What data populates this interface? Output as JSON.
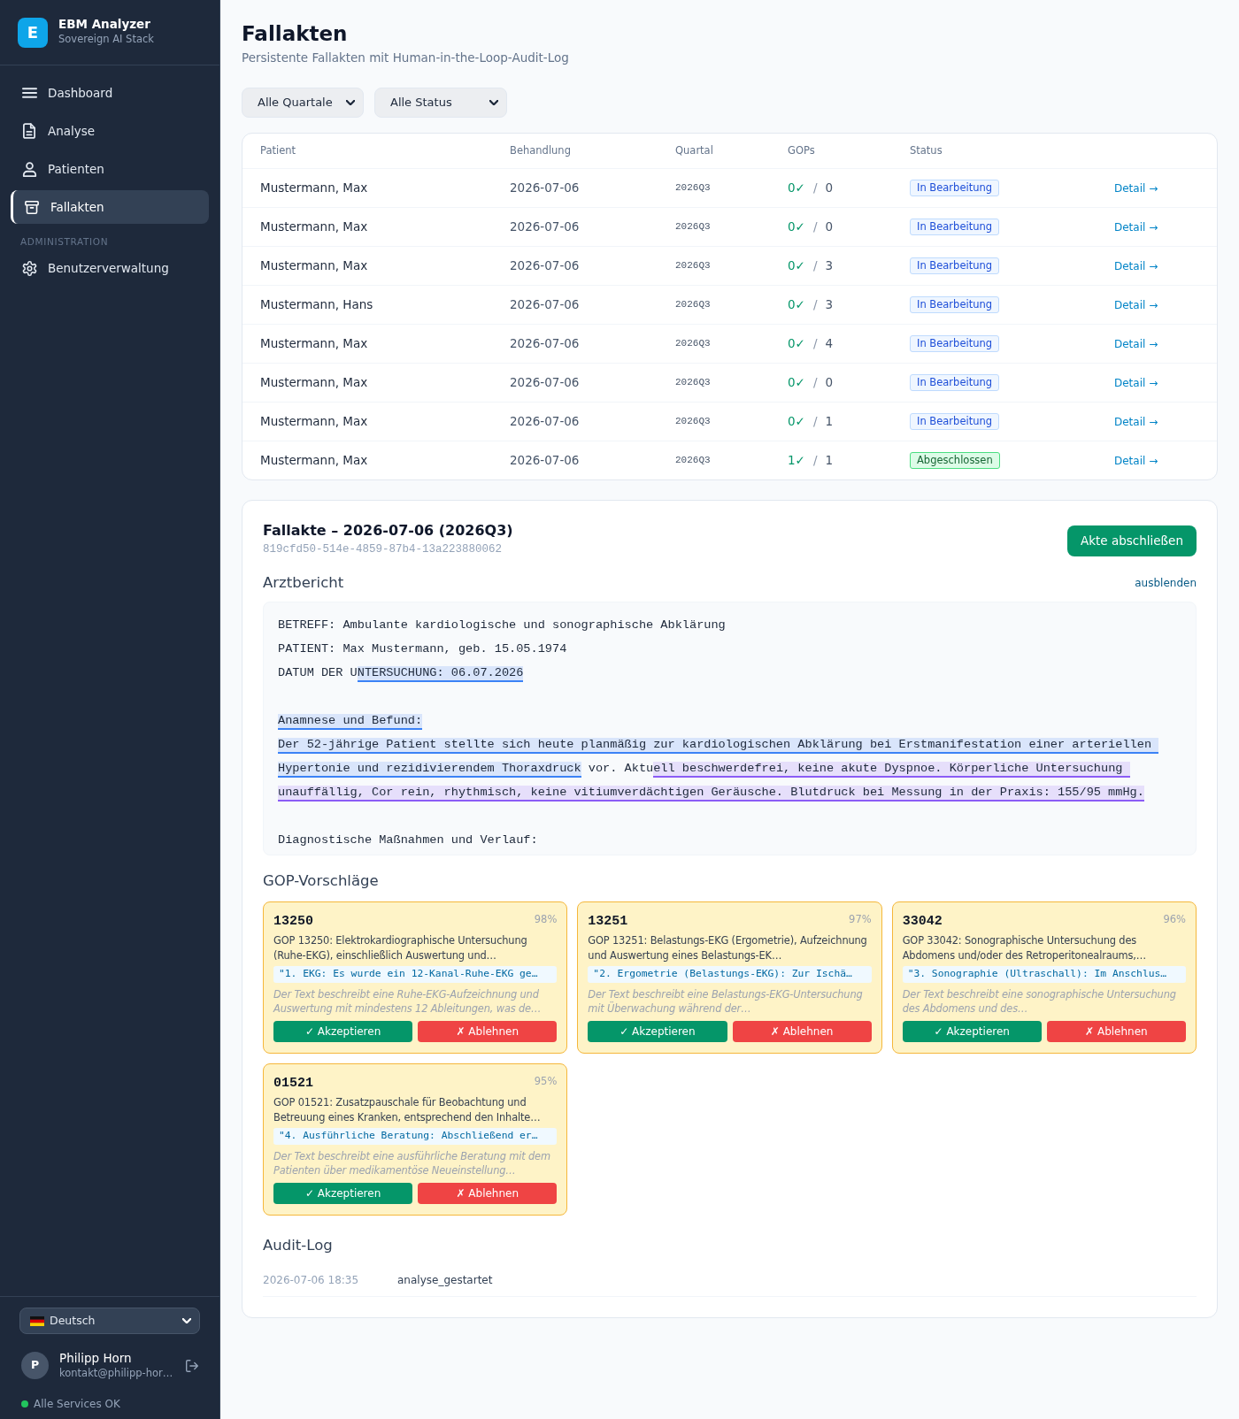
{
  "sidebar": {
    "brand": {
      "logo": "E",
      "title": "EBM Analyzer",
      "subtitle": "Sovereign AI Stack"
    },
    "groups": [
      {
        "items": [
          {
            "label": "Dashboard",
            "selected": false
          },
          {
            "label": "Analyse",
            "selected": false
          },
          {
            "label": "Patienten",
            "selected": false
          },
          {
            "label": "Fallakten",
            "selected": true
          }
        ]
      },
      {
        "heading": "ADMINISTRATION",
        "items": [
          {
            "label": "Benutzerverwaltung",
            "selected": false
          }
        ]
      }
    ],
    "language": {
      "value": "Deutsch"
    },
    "user": {
      "avatar": "P",
      "name": "Philipp Horn",
      "email": "kontakt@philipp-hor…"
    },
    "service_status": {
      "label": "Alle Services OK"
    }
  },
  "page": {
    "title": "Fallakten",
    "subtitle": "Persistente Fallakten mit Human-in-the-Loop-Audit-Log"
  },
  "filters": [
    {
      "value": "Alle Quartale"
    },
    {
      "value": "Alle Status"
    }
  ],
  "table": {
    "columns": [
      "Patient",
      "Behandlung",
      "Quartal",
      "GOPs",
      "Status"
    ],
    "rows": [
      {
        "patient": "Mustermann, Max",
        "date": "2026-07-06",
        "quarter": "2026Q3",
        "gops": {
          "accepted": "0✓",
          "separator": "/",
          "total": "0"
        },
        "status": {
          "label": "In Bearbeitung",
          "kind": "progress"
        },
        "link": "Detail →"
      },
      {
        "patient": "Mustermann, Max",
        "date": "2026-07-06",
        "quarter": "2026Q3",
        "gops": {
          "accepted": "0✓",
          "separator": "/",
          "total": "0"
        },
        "status": {
          "label": "In Bearbeitung",
          "kind": "progress"
        },
        "link": "Detail →"
      },
      {
        "patient": "Mustermann, Max",
        "date": "2026-07-06",
        "quarter": "2026Q3",
        "gops": {
          "accepted": "0✓",
          "separator": "/",
          "total": "3"
        },
        "status": {
          "label": "In Bearbeitung",
          "kind": "progress"
        },
        "link": "Detail →"
      },
      {
        "patient": "Mustermann, Hans",
        "date": "2026-07-06",
        "quarter": "2026Q3",
        "gops": {
          "accepted": "0✓",
          "separator": "/",
          "total": "3"
        },
        "status": {
          "label": "In Bearbeitung",
          "kind": "progress"
        },
        "link": "Detail →"
      },
      {
        "patient": "Mustermann, Max",
        "date": "2026-07-06",
        "quarter": "2026Q3",
        "gops": {
          "accepted": "0✓",
          "separator": "/",
          "total": "4"
        },
        "status": {
          "label": "In Bearbeitung",
          "kind": "progress"
        },
        "link": "Detail →"
      },
      {
        "patient": "Mustermann, Max",
        "date": "2026-07-06",
        "quarter": "2026Q3",
        "gops": {
          "accepted": "0✓",
          "separator": "/",
          "total": "0"
        },
        "status": {
          "label": "In Bearbeitung",
          "kind": "progress"
        },
        "link": "Detail →"
      },
      {
        "patient": "Mustermann, Max",
        "date": "2026-07-06",
        "quarter": "2026Q3",
        "gops": {
          "accepted": "0✓",
          "separator": "/",
          "total": "1"
        },
        "status": {
          "label": "In Bearbeitung",
          "kind": "progress"
        },
        "link": "Detail →"
      },
      {
        "patient": "Mustermann, Max",
        "date": "2026-07-06",
        "quarter": "2026Q3",
        "gops": {
          "accepted": "1✓",
          "separator": "/",
          "total": "1"
        },
        "status": {
          "label": "Abgeschlossen",
          "kind": "done"
        },
        "link": "Detail →"
      }
    ]
  },
  "case_file": {
    "title": "Fallakte – 2026-07-06 (2026Q3)",
    "id": "819cfd50-514e-4859-87b4-13a223880062",
    "close_button": "Akte abschließen",
    "report": {
      "heading": "Arztbericht",
      "toggle": "ausblenden",
      "blocks": [
        {
          "lines": [
            [
              {
                "text": "BETREFF: Ambulante kardiologische und sonographische Abklärung"
              }
            ],
            [
              {
                "text": "PATIENT: Max Mustermann, geb. 15.05.1974"
              }
            ],
            [
              {
                "text": "DATUM DER U"
              },
              {
                "text": "NTERSUCHUNG: 06.07.2026",
                "color": "#3b82f6"
              }
            ]
          ]
        },
        {
          "lines": [
            [
              {
                "text": "Anamnese und Befund:",
                "color": "#3b82f6"
              }
            ],
            [
              {
                "text": "Der 52-jährige Patient stellte sich heute planmäßig zur kardiologischen Abklärung bei Erstmanifestation einer arteriellen ",
                "color": "#3b82f6"
              }
            ],
            [
              {
                "text": "Hypertonie und rezidivierendem Thoraxdruck",
                "color": "#3b82f6"
              },
              {
                "text": " vor. Aktu"
              },
              {
                "text": "ell beschwerdefrei, keine akute Dyspnoe. Körperliche Untersuchung ",
                "color": "#8b5cf6"
              }
            ],
            [
              {
                "text": "unauffällig, Cor rein, rhythmisch, keine vitiumverdächtigen Geräusche. Blutdruck bei Messung in der Praxis: 155/95 mmHg.",
                "color": "#8b5cf6"
              }
            ]
          ]
        },
        {
          "lines": [
            [
              {
                "text": "Diagnostische Maßnahmen und Verlauf:"
              }
            ]
          ]
        }
      ]
    },
    "suggestions": {
      "heading": "GOP-Vorschläge",
      "cards": [
        {
          "code": "13250",
          "confidence": "98%",
          "description": "GOP 13250: Elektrokardiographische Untersuchung (Ruhe-EKG), einschließlich Auswertung und…",
          "quote": "\"1. EKG: Es wurde ein 12-Kanal-Ruhe-EKG ge…",
          "reasoning": "Der Text beschreibt eine Ruhe-EKG-Aufzeichnung und Auswertung mit mindestens 12 Ableitungen, was de…",
          "accept": "✓ Akzeptieren",
          "reject": "✗ Ablehnen"
        },
        {
          "code": "13251",
          "confidence": "97%",
          "description": "GOP 13251: Belastungs-EKG (Ergometrie), Aufzeichnung und Auswertung eines Belastungs-EK…",
          "quote": "\"2. Ergometrie (Belastungs-EKG): Zur Ischä…",
          "reasoning": "Der Text beschreibt eine Belastungs-EKG-Untersuchung mit Überwachung während der…",
          "accept": "✓ Akzeptieren",
          "reject": "✗ Ablehnen"
        },
        {
          "code": "33042",
          "confidence": "96%",
          "description": "GOP 33042: Sonographische Untersuchung des Abdomens und/oder des Retroperitonealraums,…",
          "quote": "\"3. Sonographie (Ultraschall): Im Anschlus…",
          "reasoning": "Der Text beschreibt eine sonographische Untersuchung des Abdomens und des…",
          "accept": "✓ Akzeptieren",
          "reject": "✗ Ablehnen"
        },
        {
          "code": "01521",
          "confidence": "95%",
          "description": "GOP 01521: Zusatzpauschale für Beobachtung und Betreuung eines Kranken, entsprechend den Inhalte…",
          "quote": "\"4. Ausführliche Beratung: Abschließend er…",
          "reasoning": "Der Text beschreibt eine ausführliche Beratung mit dem Patienten über medikamentöse Neueinstellung…",
          "accept": "✓ Akzeptieren",
          "reject": "✗ Ablehnen"
        }
      ]
    },
    "audit": {
      "heading": "Audit-Log",
      "entries": [
        {
          "time": "2026-07-06 18:35",
          "event": "analyse_gestartet"
        }
      ]
    }
  }
}
